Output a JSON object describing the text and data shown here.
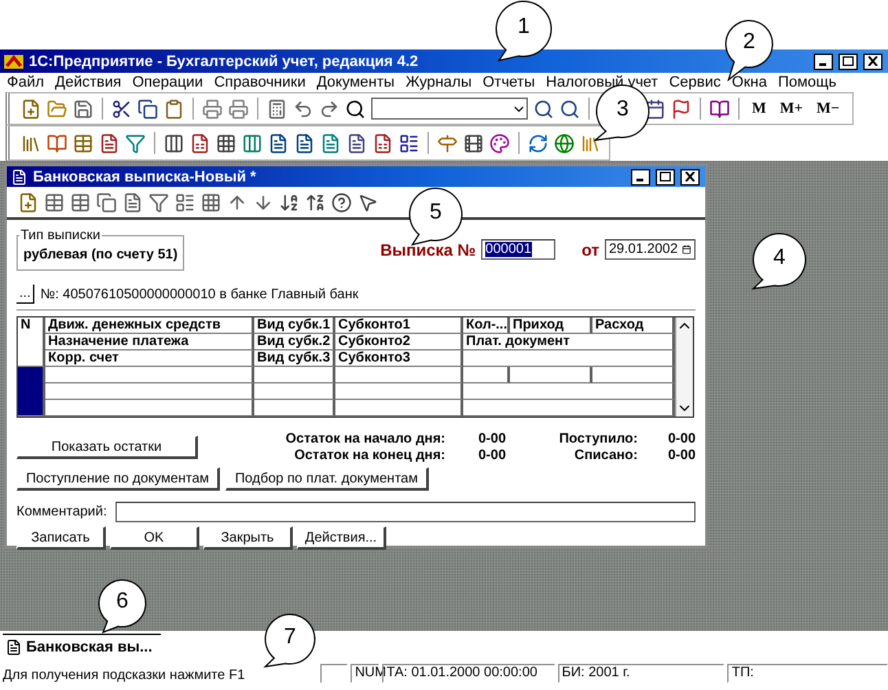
{
  "window": {
    "title": "1С:Предприятие - Бухгалтерский учет, редакция 4.2"
  },
  "menu": [
    "Файл",
    "Действия",
    "Операции",
    "Справочники",
    "Документы",
    "Журналы",
    "Отчеты",
    "Налоговый учет",
    "Сервис",
    "Окна",
    "Помощь"
  ],
  "toolbar": {
    "text_buttons": [
      "M",
      "M+",
      "M−"
    ]
  },
  "document_window": {
    "title": "Банковская выписка-Новый *",
    "statement_type": {
      "legend": "Тип выписки",
      "value": "рублевая (по счету 51)"
    },
    "number_label": "Выписка №",
    "number": {
      "value": "000001",
      "selected": true
    },
    "date_label": "от",
    "date": "29.01.2002",
    "account_button": "...",
    "account": "№: 40507610500000000010 в банке Главный банк",
    "table": {
      "header": [
        [
          "N",
          "Движ. денежных средств",
          "Вид субк.1",
          "Субконто1",
          "Кол-...",
          "Приход",
          "Расход"
        ],
        [
          "Назначение платежа",
          "Вид субк.2",
          "Субконто2",
          "Плат.  документ"
        ],
        [
          "Корр. счет",
          "Вид субк.3",
          "Субконто3"
        ]
      ],
      "rows": [
        {
          "selected": true
        }
      ]
    },
    "show_balance_button": "Показать остатки",
    "totals": [
      {
        "label": "Остаток на начало дня:",
        "value": "0-00",
        "label2": "Поступило:",
        "value2": "0-00"
      },
      {
        "label": "Остаток на конец дня:",
        "value": "0-00",
        "label2": "Списано:",
        "value2": "0-00"
      }
    ],
    "doc_buttons": [
      "Поступление по документам",
      "Подбор по плат. документам"
    ],
    "comment_label": "Комментарий:",
    "buttons": [
      "Записать",
      "OK",
      "Закрыть",
      "Действия..."
    ]
  },
  "window_bar": [
    {
      "label": "Банковская вы...",
      "selected": true
    }
  ],
  "status_bar": {
    "hint": "Для получения подсказки нажмите F1",
    "panels": [
      "NUM",
      "ТА: 01.01.2000  00:00:00",
      "БИ: 2001 г.",
      "ТП:"
    ]
  },
  "callouts": [
    "1",
    "2",
    "3",
    "4",
    "5",
    "6",
    "7"
  ]
}
